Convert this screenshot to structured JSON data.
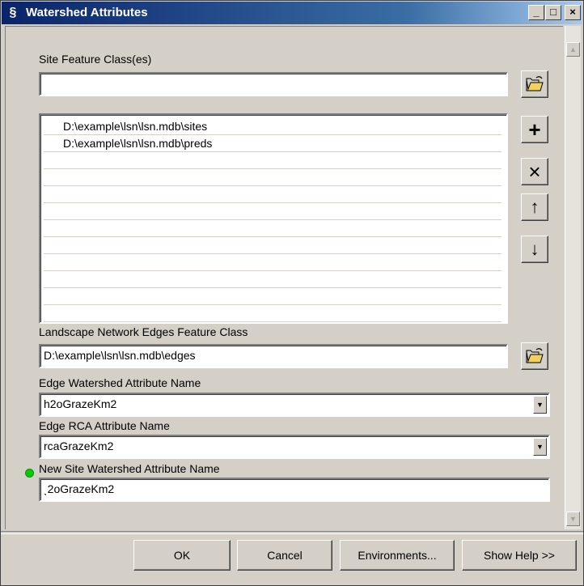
{
  "window": {
    "title": "Watershed Attributes",
    "icon": "app-s-icon"
  },
  "titlebar_buttons": {
    "minimize": "_",
    "maximize": "□",
    "close": "×"
  },
  "site_feature_classes": {
    "label": "Site Feature Class(es)",
    "input_value": "",
    "items": [
      "D:\\example\\lsn\\lsn.mdb\\sites",
      "D:\\example\\lsn\\lsn.mdb\\preds",
      "",
      "",
      "",
      "",
      "",
      "",
      "",
      "",
      "",
      ""
    ]
  },
  "list_buttons": {
    "add": "+",
    "remove": "×",
    "up": "↑",
    "down": "↓"
  },
  "edges": {
    "label": "Landscape Network Edges Feature Class",
    "value": "D:\\example\\lsn\\lsn.mdb\\edges"
  },
  "edge_watershed": {
    "label": "Edge Watershed Attribute Name",
    "value": "h2oGrazeKm2"
  },
  "edge_rca": {
    "label": "Edge RCA Attribute Name",
    "value": "rcaGrazeKm2"
  },
  "new_site_watershed": {
    "label": "New Site Watershed Attribute Name",
    "value": "ˎ2oGrazeKm2"
  },
  "buttons": {
    "ok": "OK",
    "cancel": "Cancel",
    "environments": "Environments...",
    "show_help": "Show Help >>"
  },
  "colors": {
    "title_start": "#0a246a",
    "title_end": "#a6caf0",
    "face": "#d4d0c8",
    "required_dot": "#00cc00"
  }
}
